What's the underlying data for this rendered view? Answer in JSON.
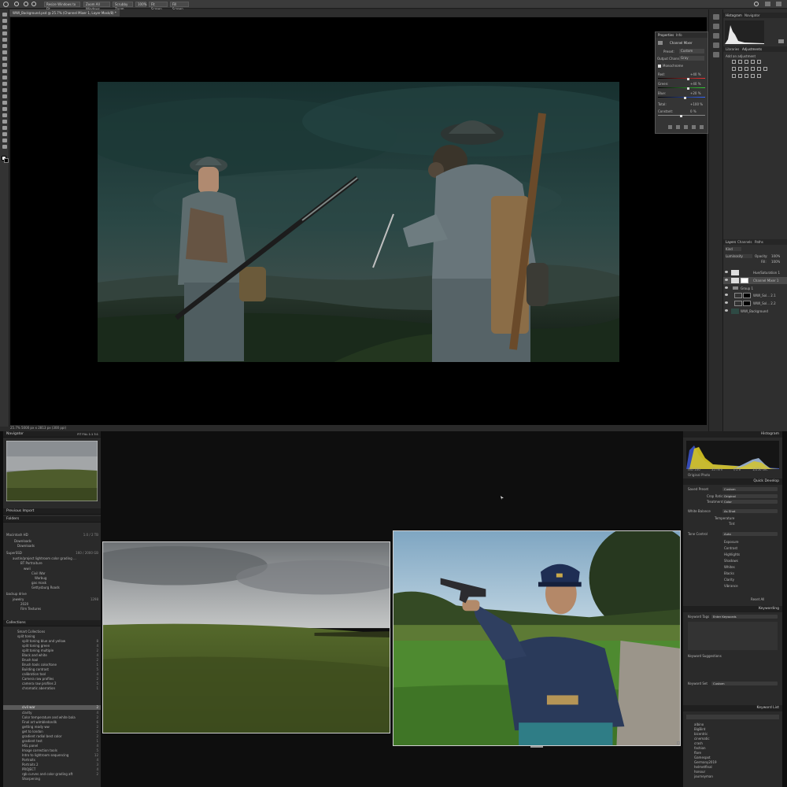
{
  "photoshop": {
    "options_bar": {
      "resize_windows": "Resize Windows to Fit",
      "zoom_all": "Zoom All Windows",
      "scrubby_zoom": "Scrubby Zoom",
      "zoom_100": "100%",
      "fit_screen": "Fit Screen",
      "fill_screen": "Fill Screen"
    },
    "document_tab": "WWI_Background.psd @ 25.7% (Channel Mixer 1, Layer Mask/8) *",
    "status_bar": "25.7%     5000 px x 2813 px (300 ppi)",
    "right_tabs": {
      "histogram": "Histogram",
      "navigator": "Navigator",
      "libraries": "Libraries",
      "adjustments": "Adjustments"
    },
    "adjustments_hint": "Add an adjustment",
    "properties": {
      "tabs": [
        "Properties",
        "Info"
      ],
      "title": "Channel Mixer",
      "preset_label": "Preset:",
      "preset_value": "Custom",
      "output_label": "Output Channel:",
      "output_value": "Gray",
      "monochrome": "Monochrome",
      "sliders": [
        {
          "label": "Red:",
          "value": "+40 %"
        },
        {
          "label": "Green:",
          "value": "+40 %"
        },
        {
          "label": "Blue:",
          "value": "+20 %"
        }
      ],
      "total_label": "Total:",
      "total_value": "+100 %",
      "constant_label": "Constant:",
      "constant_value": "0 %"
    },
    "layers_panel": {
      "tabs": [
        "Layers",
        "Channels",
        "Paths"
      ],
      "kind": "Kind",
      "blend": "Luminosity",
      "opacity_label": "Opacity:",
      "opacity": "100%",
      "fill_label": "Fill:",
      "fill": "100%",
      "layers": [
        "Hue/Saturation 1",
        "Channel Mixer 1",
        "Group 1",
        "WWI_Sol... 2.1",
        "WWI_Sol... 2.2",
        "WWI_Background"
      ]
    }
  },
  "lightroom": {
    "navigator": {
      "title": "Navigator",
      "zoom": "FIT  FILL  1:1  3:1"
    },
    "preview_import": "Previous Import",
    "folders": {
      "title": "Folders",
      "volume": "Macintosh HD",
      "volume_size": "1.0 / 2 TB",
      "rows": [
        {
          "label": "Downloads",
          "count": ""
        },
        {
          "label": "Downloads",
          "count": ""
        },
        {
          "label": "SuperSSD",
          "count": "160 / 2000 GB"
        },
        {
          "label": "austin/project lightroom color grading ...",
          "count": ""
        },
        {
          "label": "BT Portraiture",
          "count": ""
        },
        {
          "label": "wwii",
          "count": ""
        },
        {
          "label": "Civil War",
          "count": ""
        },
        {
          "label": "Warbug",
          "count": ""
        },
        {
          "label": "gas mask",
          "count": ""
        },
        {
          "label": "Gettysburg Roads",
          "count": ""
        },
        {
          "label": "backup drive",
          "count": ""
        },
        {
          "label": "jewelry",
          "count": "1298"
        },
        {
          "label": "2020",
          "count": ""
        },
        {
          "label": "Film Textures",
          "count": ""
        }
      ]
    },
    "collections": {
      "title": "Collections",
      "rows": [
        {
          "label": "Smart Collections",
          "count": ""
        },
        {
          "label": "split toning",
          "count": ""
        },
        {
          "label": "split toning blue and yellow",
          "count": "8"
        },
        {
          "label": "split toning green",
          "count": "4"
        },
        {
          "label": "split toning multiple",
          "count": "2"
        },
        {
          "label": "Black and white",
          "count": "4"
        },
        {
          "label": "Brush tool",
          "count": "2"
        },
        {
          "label": "Brush tools color/tone",
          "count": "1"
        },
        {
          "label": "Building contrast",
          "count": "5"
        },
        {
          "label": "calibration tool",
          "count": "4"
        },
        {
          "label": "Camera raw profiles",
          "count": "2"
        },
        {
          "label": "camera raw profiles 2",
          "count": "5"
        },
        {
          "label": "chromatic aberration",
          "count": "1"
        },
        {
          "label": "civil war",
          "count": "2"
        },
        {
          "label": "clarity",
          "count": "4"
        },
        {
          "label": "Color temperature and white bala",
          "count": "2"
        },
        {
          "label": "Final art wimbledon4k",
          "count": "6"
        },
        {
          "label": "getting ready ww",
          "count": "2"
        },
        {
          "label": "get to london",
          "count": "2"
        },
        {
          "label": "gradient radial best color",
          "count": "2"
        },
        {
          "label": "gradient test",
          "count": "1"
        },
        {
          "label": "HSL panel",
          "count": "4"
        },
        {
          "label": "Image correction tools",
          "count": "5"
        },
        {
          "label": "Intro to lightroom sequencing",
          "count": "12"
        },
        {
          "label": "Portraits",
          "count": "4"
        },
        {
          "label": "Portraits 2",
          "count": "3"
        },
        {
          "label": "PROJECT",
          "count": "4"
        },
        {
          "label": "rgb curves and color grading aft",
          "count": "2"
        },
        {
          "label": "Sharpening",
          "count": ""
        }
      ]
    },
    "histogram": {
      "title": "Histogram",
      "exif": [
        "ISO 100",
        "35 mm",
        "f/5.6",
        "1/250 sec"
      ],
      "badge": "Original Photo"
    },
    "quick_develop": {
      "title": "Quick Develop",
      "saved_preset_label": "Saved Preset",
      "saved_preset": "Custom",
      "crop_label": "Crop Ratio",
      "crop": "Original",
      "treatment_label": "Treatment",
      "treatment": "Color",
      "wb_label": "White Balance",
      "wb": "As Shot",
      "temp_label": "Temperature",
      "tint_label": "Tint",
      "tone_label": "Tone Control",
      "tone": "Auto",
      "tone_rows": [
        "Exposure",
        "Contrast",
        "Highlights",
        "Shadows",
        "Whites",
        "Blacks",
        "Clarity",
        "Vibrance"
      ],
      "reset": "Reset All"
    },
    "keywording": {
      "title": "Keywording",
      "tags_label": "Keyword Tags",
      "tags_value": "Enter Keywords",
      "suggestions_label": "Keyword Suggestions",
      "set_label": "Keyword Set",
      "set_value": "Custom"
    },
    "keyword_list": {
      "title": "Keyword List",
      "items": [
        "albino",
        "BigBird",
        "bicentric",
        "cinematic",
        "crash",
        "fashion",
        "flare",
        "Gamespot",
        "Germany2019",
        "helmetfinal",
        "honour",
        "journeyman"
      ]
    }
  }
}
